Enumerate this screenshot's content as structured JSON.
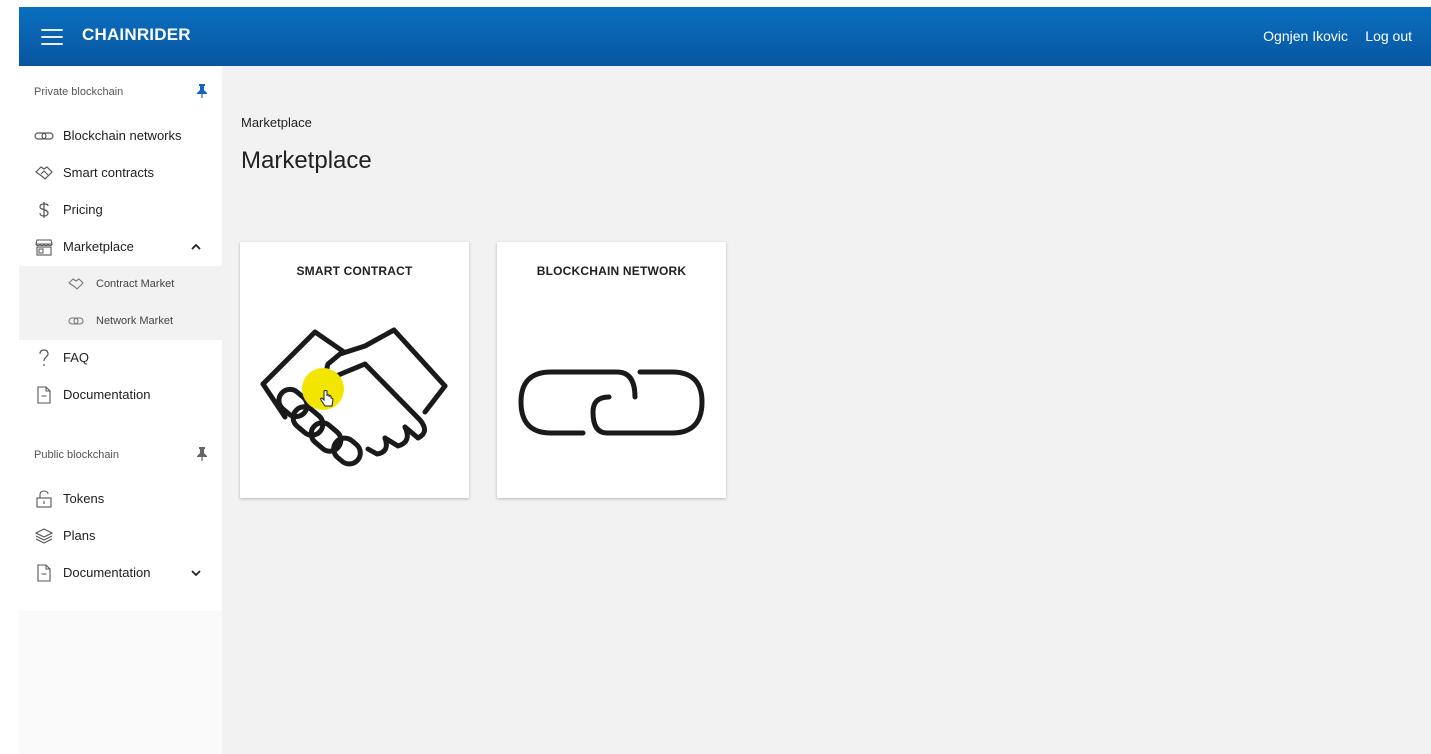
{
  "header": {
    "brand": "CHAINRIDER",
    "user_name": "Ognjen Ikovic",
    "logout_label": "Log out",
    "menu_icon": "hamburger-icon",
    "color": "#0a6fc0"
  },
  "sidebar": {
    "private_section": {
      "title": "Private blockchain",
      "pin_icon": "pin-icon",
      "items": [
        {
          "label": "Blockchain networks",
          "icon": "link-icon"
        },
        {
          "label": "Smart contracts",
          "icon": "handshake-icon"
        },
        {
          "label": "Pricing",
          "icon": "dollar-icon"
        },
        {
          "label": "Marketplace",
          "icon": "store-icon",
          "expanded": true,
          "children": [
            {
              "label": "Contract Market",
              "icon": "handshake-icon"
            },
            {
              "label": "Network Market",
              "icon": "link-icon"
            }
          ]
        },
        {
          "label": "FAQ",
          "icon": "question-icon"
        },
        {
          "label": "Documentation",
          "icon": "document-icon"
        }
      ]
    },
    "public_section": {
      "title": "Public blockchain",
      "pin_icon": "pin-icon",
      "items": [
        {
          "label": "Tokens",
          "icon": "lock-icon"
        },
        {
          "label": "Plans",
          "icon": "layers-icon"
        },
        {
          "label": "Documentation",
          "icon": "document-icon",
          "expanded": false
        }
      ]
    }
  },
  "main": {
    "breadcrumb": "Marketplace",
    "title": "Marketplace",
    "cards": [
      {
        "title": "SMART CONTRACT",
        "icon": "handshake-icon"
      },
      {
        "title": "BLOCKCHAIN NETWORK",
        "icon": "link-icon"
      }
    ]
  },
  "colors": {
    "accent": "#0a6fc0",
    "pin": "#1565c0",
    "cursor_highlight": "#f2e600"
  }
}
